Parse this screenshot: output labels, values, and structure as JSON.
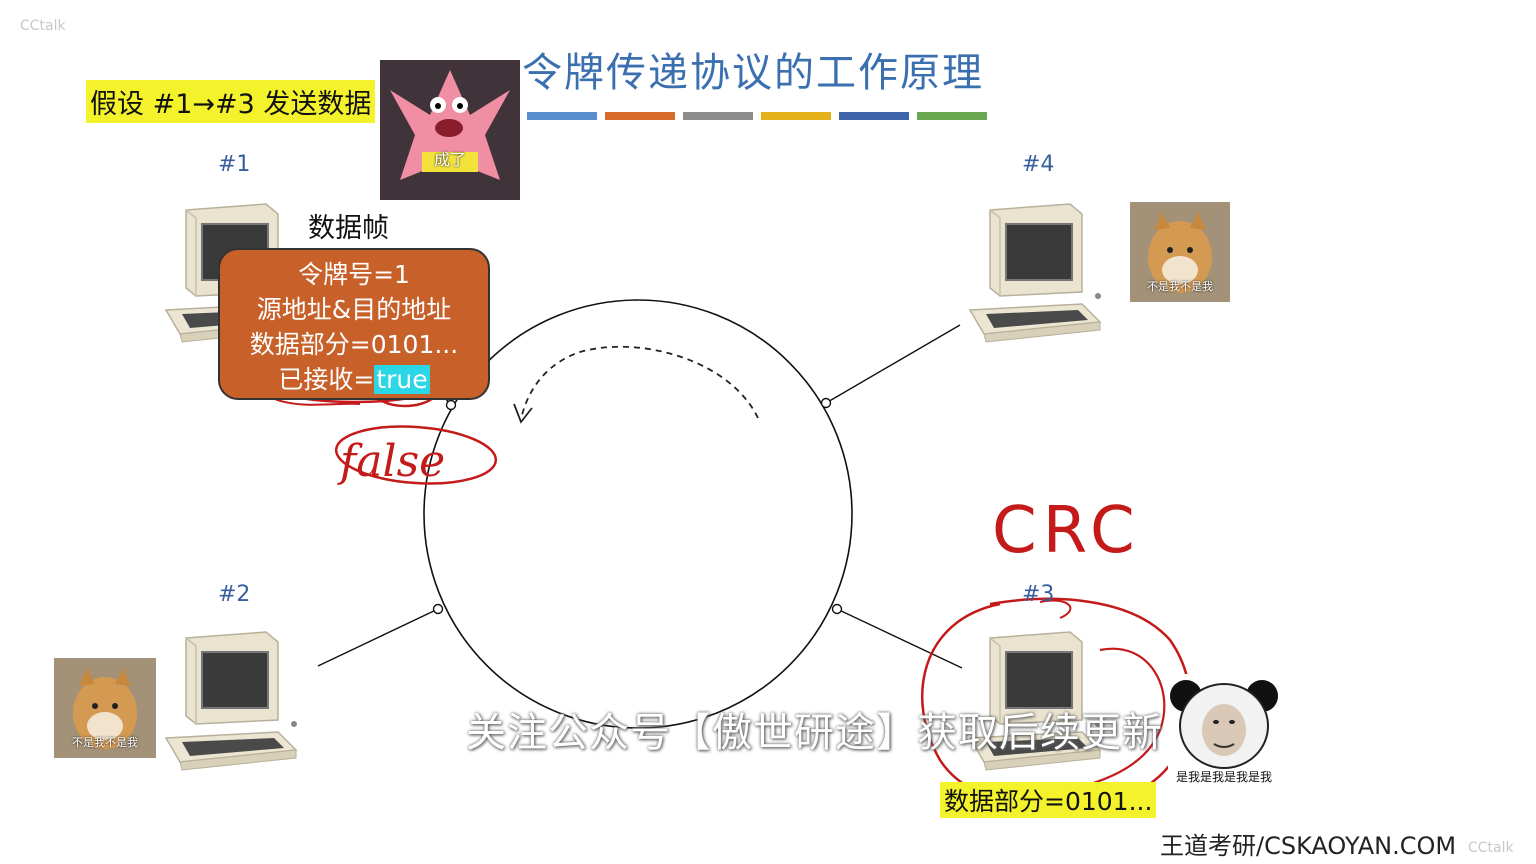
{
  "watermark_top": "CCtalk",
  "watermark_bottom": "CCtalk",
  "title": "令牌传递协议的工作原理",
  "title_bar_colors": [
    "#5a8fcf",
    "#d86a2a",
    "#8c8c8c",
    "#e3b21a",
    "#3d64a8",
    "#6aa84f"
  ],
  "assumption": "假设 #1→#3 发送数据",
  "nodes": {
    "n1": "#1",
    "n2": "#2",
    "n3": "#3",
    "n4": "#4"
  },
  "frame": {
    "caption": "数据帧",
    "token": "令牌号=1",
    "address": "源地址&目的地址",
    "data": "数据部分=0101...",
    "received_label": "已接收=",
    "received_value": "true"
  },
  "annotations": {
    "false": "false",
    "crc": "CRC"
  },
  "memes": {
    "patrick_caption": "成了",
    "doge4_caption": "不是我不是我",
    "doge2_caption": "不是我不是我",
    "panda_caption": "是我是我是我是我"
  },
  "node3_data": "数据部分=0101...",
  "subtitle": "关注公众号【傲世研途】获取后续更新",
  "brand": "王道考研/CSKAOYAN.COM"
}
